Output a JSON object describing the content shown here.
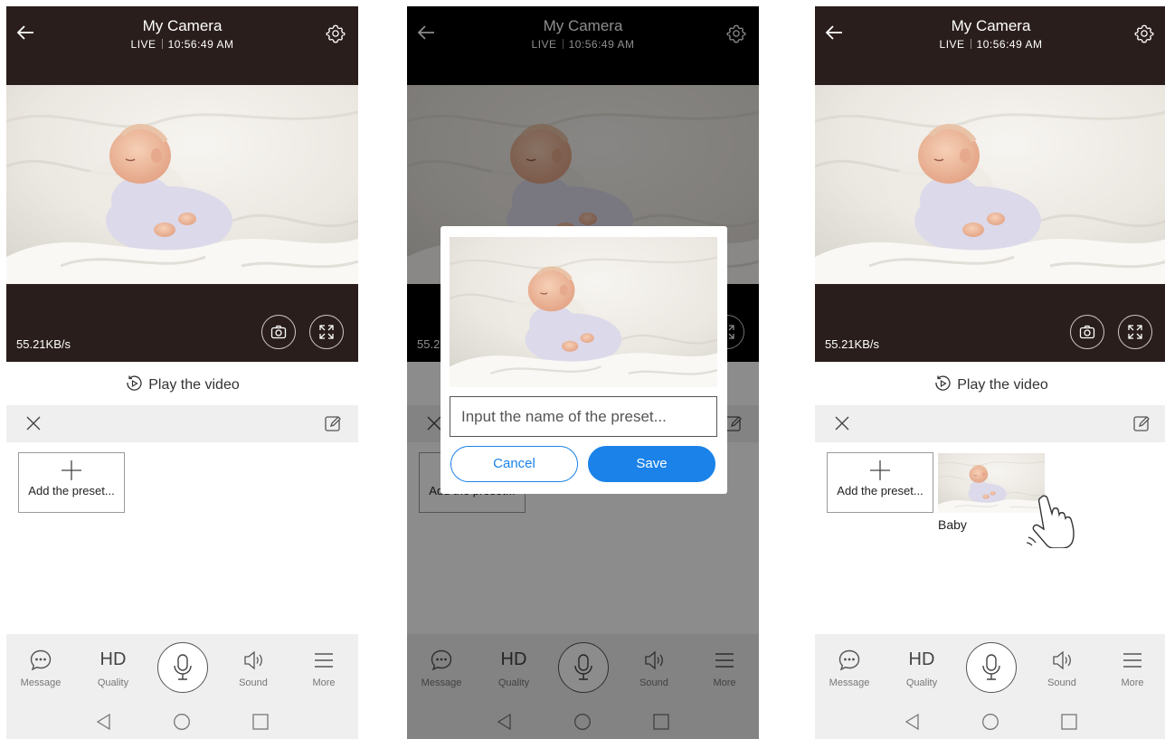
{
  "header": {
    "title": "My Camera",
    "live_label": "LIVE",
    "time": "10:56:49 AM"
  },
  "video": {
    "data_rate": "55.21KB/s"
  },
  "playback": {
    "label": "Play the video"
  },
  "presets": {
    "add_label": "Add the preset...",
    "saved": [
      {
        "name": "Baby"
      }
    ]
  },
  "toolbar": {
    "message_label": "Message",
    "quality_value": "HD",
    "quality_label": "Quality",
    "sound_label": "Sound",
    "more_label": "More"
  },
  "dialog": {
    "input_placeholder": "Input the name of the preset...",
    "cancel_label": "Cancel",
    "save_label": "Save"
  },
  "colors": {
    "header_bg": "#2a1e1c",
    "accent": "#1a82e8",
    "toolbar_bg": "#efefef"
  },
  "icons": [
    "back-arrow-icon",
    "settings-gear-icon",
    "camera-snapshot-icon",
    "fullscreen-icon",
    "replay-icon",
    "close-icon",
    "edit-icon",
    "plus-icon",
    "message-icon",
    "microphone-icon",
    "speaker-icon",
    "menu-icon",
    "nav-back-icon",
    "nav-home-icon",
    "nav-recents-icon",
    "hand-pointer-icon"
  ]
}
